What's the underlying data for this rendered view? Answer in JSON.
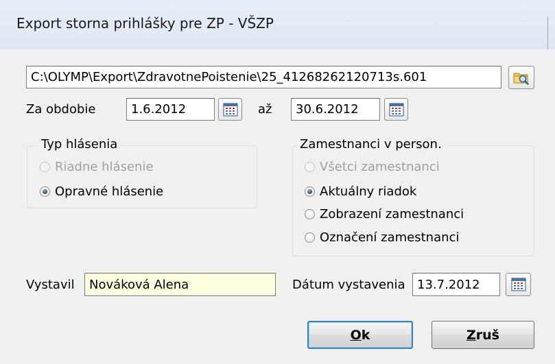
{
  "window": {
    "title": "Export storna prihlášky pre ZP - VŠZP"
  },
  "file": {
    "path": "C:\\OLYMP\\Export\\ZdravotnePoistenie\\25_41268262120713s.601",
    "browse_icon": "folder-search-icon"
  },
  "period": {
    "label": "Za obdobie",
    "from": "1.6.2012",
    "separator": "až",
    "to": "30.6.2012",
    "calendar_icon": "calendar-icon"
  },
  "report_type": {
    "title": "Typ hlásenia",
    "options": [
      {
        "label": "Riadne hlásenie",
        "checked": false,
        "disabled": true
      },
      {
        "label": "Opravné hlásenie",
        "checked": true,
        "disabled": false
      }
    ]
  },
  "employees": {
    "title": "Zamestnanci v person.",
    "options": [
      {
        "label": "Všetci zamestnanci",
        "checked": false,
        "disabled": true
      },
      {
        "label": "Aktuálny riadok",
        "checked": true,
        "disabled": false
      },
      {
        "label": "Zobrazení zamestnanci",
        "checked": false,
        "disabled": false
      },
      {
        "label": "Označení zamestnanci",
        "checked": false,
        "disabled": false
      }
    ]
  },
  "issuer": {
    "label": "Vystavil",
    "value": "Nováková Alena"
  },
  "issue_date": {
    "label": "Dátum vystavenia",
    "value": "13.7.2012"
  },
  "buttons": {
    "ok_mnemonic": "O",
    "ok_rest": "k",
    "cancel_mnemonic": "Z",
    "cancel_rest": "ruš"
  },
  "colors": {
    "accent": "#3c7fb1",
    "issuer_bg": "#ffffe1"
  }
}
